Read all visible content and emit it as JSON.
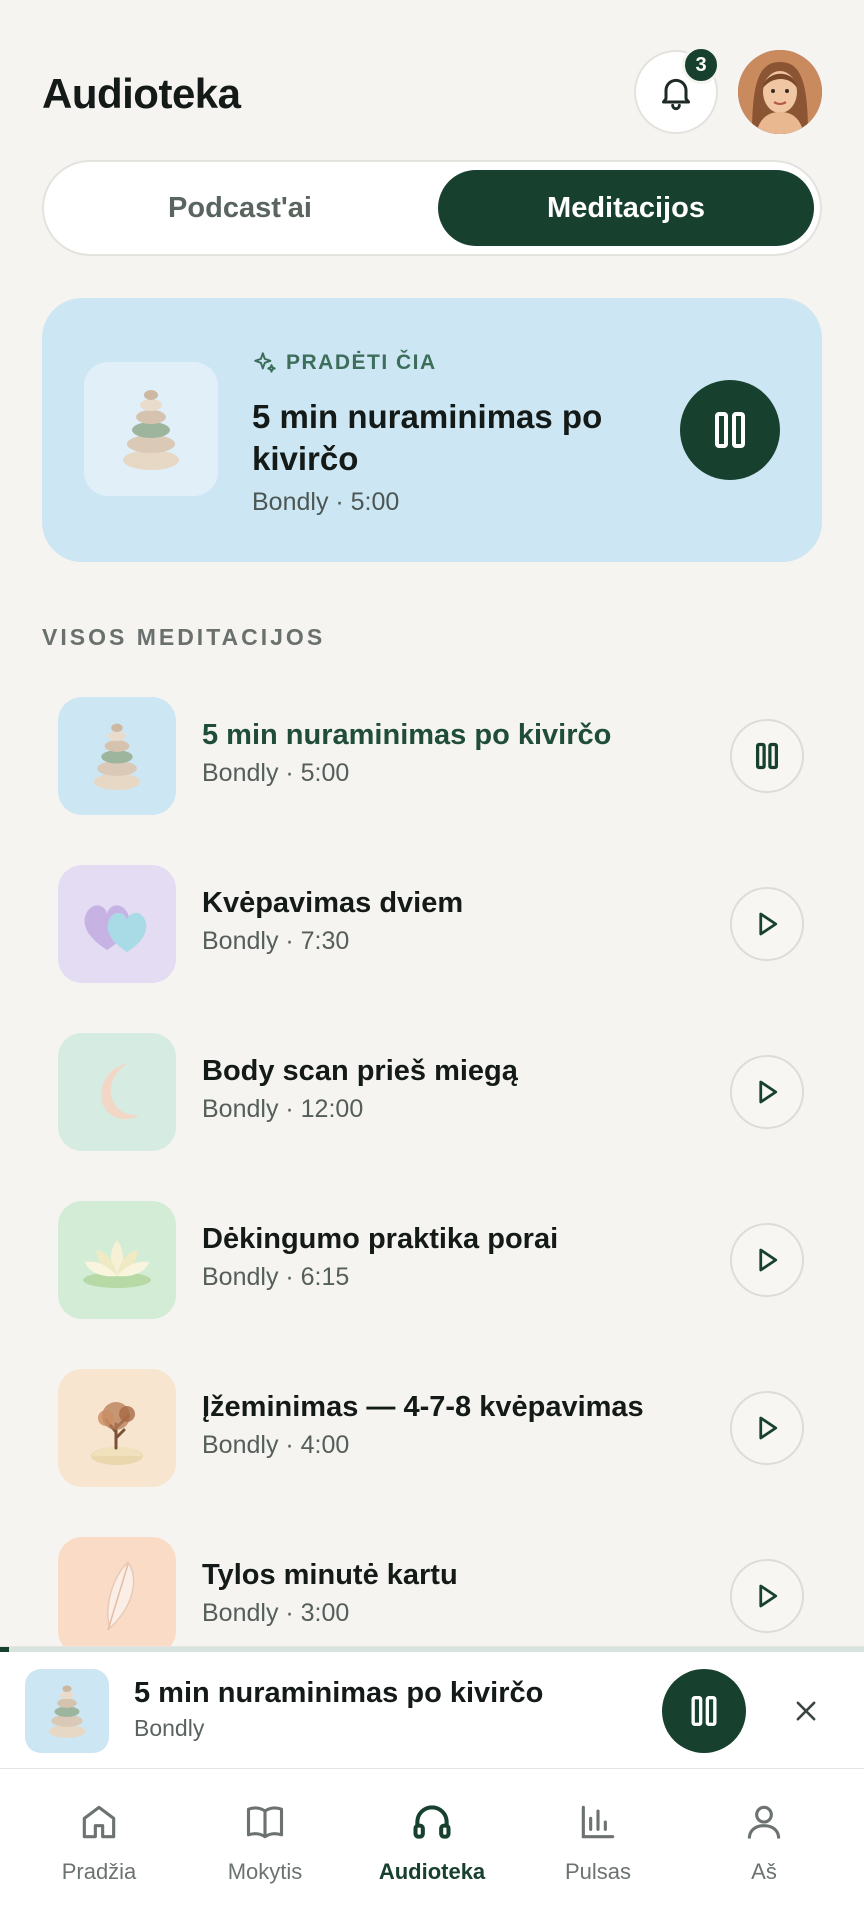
{
  "header": {
    "title": "Audioteka",
    "notification_count": "3"
  },
  "segments": {
    "podcasts": "Podcast'ai",
    "meditations": "Meditacijos"
  },
  "featured": {
    "kicker": "PRADĖTI ČIA",
    "title": "5 min nuraminimas po kivirčo",
    "meta": "Bondly · 5:00"
  },
  "section": {
    "label": "VISOS MEDITACIJOS"
  },
  "meditations": [
    {
      "title": "5 min nuraminimas po kivirčo",
      "meta": "Bondly · 5:00",
      "thumb_color": "#cde6f3",
      "icon": "stones-icon",
      "state": "playing"
    },
    {
      "title": "Kvėpavimas dviem",
      "meta": "Bondly · 7:30",
      "thumb_color": "#e4dcf3",
      "icon": "hearts-icon",
      "state": "idle"
    },
    {
      "title": "Body scan prieš miegą",
      "meta": "Bondly · 12:00",
      "thumb_color": "#d6ebe1",
      "icon": "moon-icon",
      "state": "idle"
    },
    {
      "title": "Dėkingumo praktika porai",
      "meta": "Bondly · 6:15",
      "thumb_color": "#d3ecd6",
      "icon": "lotus-icon",
      "state": "idle"
    },
    {
      "title": "Įžeminimas — 4-7-8 kvėpavimas",
      "meta": "Bondly · 4:00",
      "thumb_color": "#f7e5cf",
      "icon": "tree-icon",
      "state": "idle"
    },
    {
      "title": "Tylos minutė kartu",
      "meta": "Bondly · 3:00",
      "thumb_color": "#fadcc6",
      "icon": "feather-icon",
      "state": "idle"
    }
  ],
  "mini_player": {
    "title": "5 min nuraminimas po kivirčo",
    "subtitle": "Bondly",
    "progress": 0.01
  },
  "tabbar": [
    {
      "label": "Pradžia",
      "icon": "home-icon"
    },
    {
      "label": "Mokytis",
      "icon": "book-icon"
    },
    {
      "label": "Audioteka",
      "icon": "headphones-icon",
      "active": true
    },
    {
      "label": "Pulsas",
      "icon": "chart-icon"
    },
    {
      "label": "Aš",
      "icon": "person-icon"
    }
  ],
  "colors": {
    "accent": "#17402f",
    "background": "#f5f4f1",
    "featured_bg": "#cde6f3"
  }
}
